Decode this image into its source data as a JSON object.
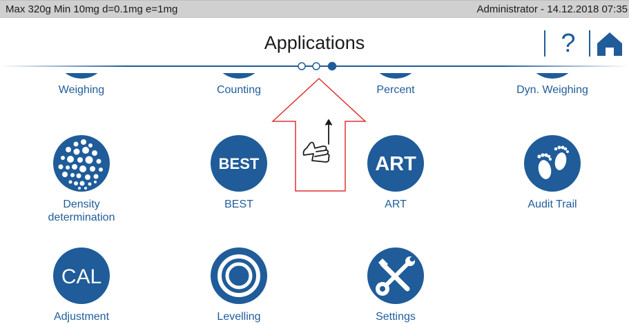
{
  "status_bar": {
    "scale_info": "Max 320g  Min 10mg  d=0.1mg  e=1mg",
    "user_datetime": "Administrator  -  14.12.2018 07:35"
  },
  "header": {
    "title": "Applications",
    "help_label": "?",
    "help_icon": "question-mark-icon",
    "home_icon": "home-icon",
    "accent_color": "#1f5c99"
  },
  "pager": {
    "pages": 3,
    "current_page": 3
  },
  "apps_partial": [
    {
      "label": "Weighing"
    },
    {
      "label": "Counting"
    },
    {
      "label": "Percent"
    },
    {
      "label": "Dyn. Weighing"
    }
  ],
  "apps": [
    {
      "label": "Density\ndetermination",
      "icon": "density-dots-icon"
    },
    {
      "label": "BEST",
      "icon": "best-icon",
      "icon_text": "BEST"
    },
    {
      "label": "ART",
      "icon": "art-icon",
      "icon_text": "ART"
    },
    {
      "label": "Audit Trail",
      "icon": "footprints-icon"
    },
    {
      "label": "Adjustment",
      "icon": "cal-icon",
      "icon_text": "CAL"
    },
    {
      "label": "Levelling",
      "icon": "level-bubble-icon"
    },
    {
      "label": "Settings",
      "icon": "tools-icon"
    }
  ],
  "overlay": {
    "type": "swipe-up-hint",
    "icon": "hand-pointer-swipe-icon",
    "color": "#e03030"
  }
}
